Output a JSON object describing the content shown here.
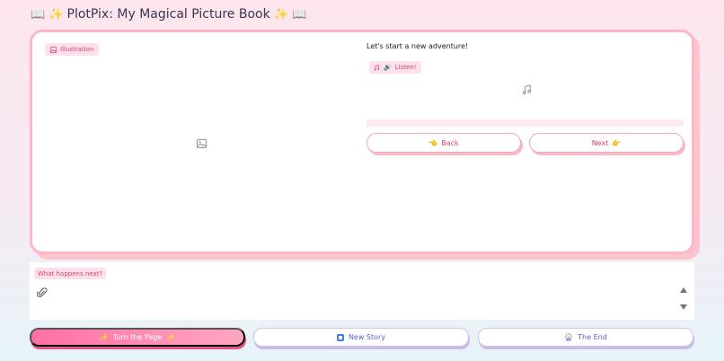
{
  "app": {
    "title": "PlotPix: My Magical Picture Book",
    "title_emoji_left": "📖 ✨",
    "title_emoji_right": "✨ 📖"
  },
  "book": {
    "illustration_label": "Illustration",
    "illustration_icon": "image-icon",
    "story_text": "Let's start a new adventure!",
    "listen_label": "Listen!",
    "listen_emoji": "🔊",
    "music_icon": "music-note-icon",
    "back_label": "Back",
    "back_emoji": "👈",
    "next_label": "Next",
    "next_emoji": "👉"
  },
  "prompt": {
    "label": "What happens next?",
    "value": "",
    "attach_icon": "paperclip-icon"
  },
  "actions": {
    "turn_label": "Turn the Page",
    "turn_emoji": "✨",
    "new_label": "New Story",
    "end_label": "The End",
    "end_emoji": "🎡"
  },
  "colors": {
    "accent_pink": "#ff6fa6",
    "label_bg": "#fde0ec",
    "label_text": "#d4456e",
    "secondary_text": "#5b5fc7"
  }
}
